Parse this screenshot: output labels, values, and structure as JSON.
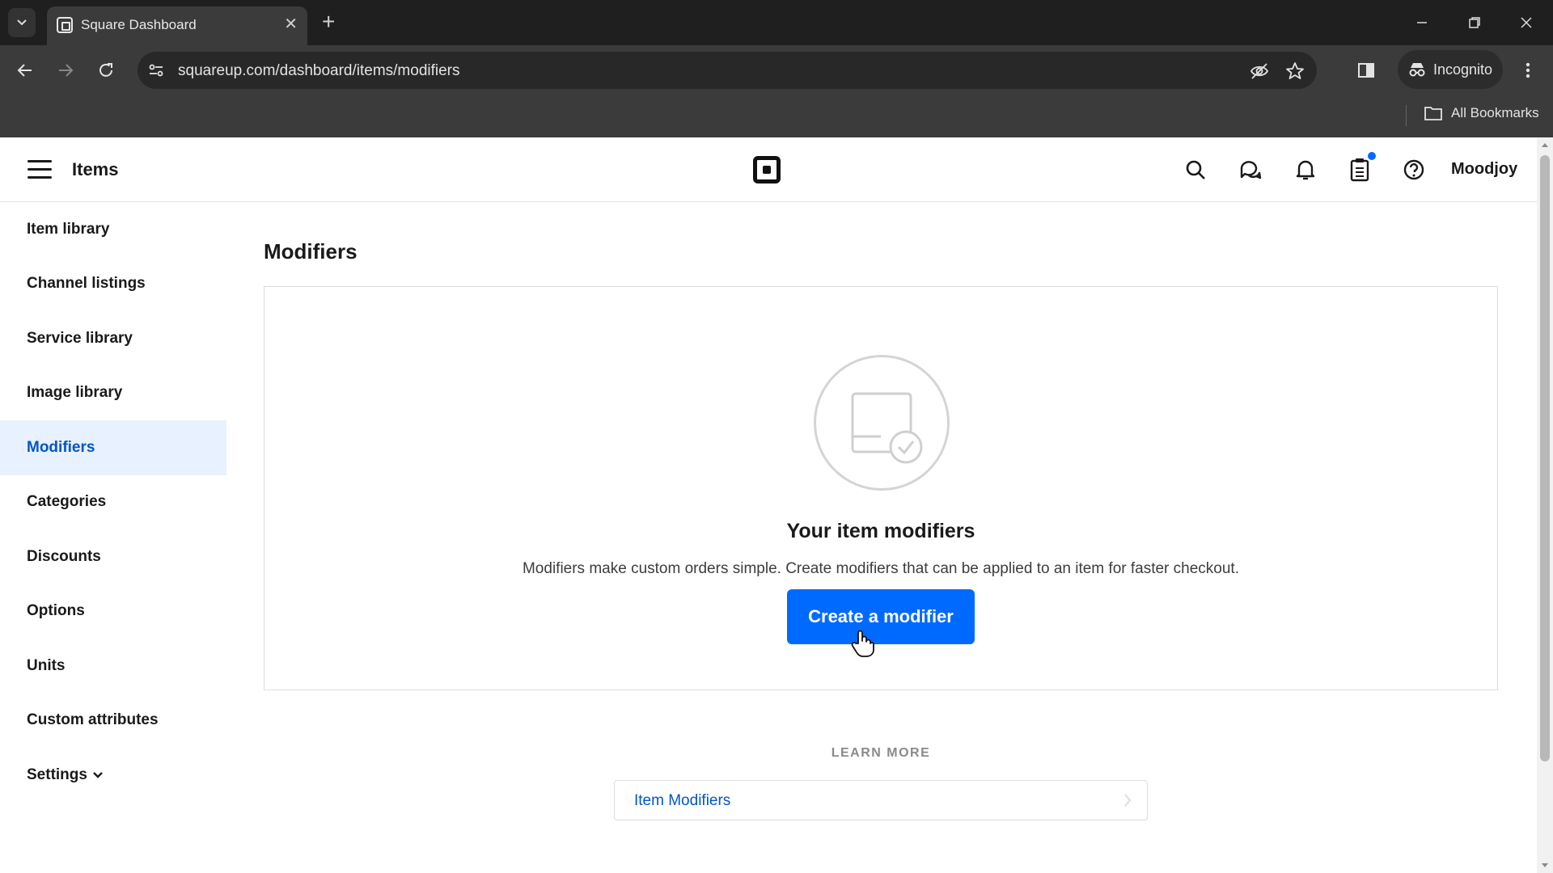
{
  "browser": {
    "tab_title": "Square Dashboard",
    "url": "squareup.com/dashboard/items/modifiers",
    "incognito_label": "Incognito",
    "bookmarks_label": "All Bookmarks"
  },
  "header": {
    "title": "Items",
    "user": "Moodjoy"
  },
  "sidebar": {
    "items": [
      {
        "label": "Item library"
      },
      {
        "label": "Channel listings"
      },
      {
        "label": "Service library"
      },
      {
        "label": "Image library"
      },
      {
        "label": "Modifiers",
        "active": true
      },
      {
        "label": "Categories"
      },
      {
        "label": "Discounts"
      },
      {
        "label": "Options"
      },
      {
        "label": "Units"
      },
      {
        "label": "Custom attributes"
      },
      {
        "label": "Settings"
      }
    ]
  },
  "main": {
    "title": "Modifiers",
    "empty_state": {
      "heading": "Your item modifiers",
      "description": "Modifiers make custom orders simple. Create modifiers that can be applied to an item for faster checkout.",
      "button_label": "Create a modifier"
    },
    "learn_more": {
      "label": "LEARN MORE",
      "links": [
        {
          "label": "Item Modifiers"
        }
      ]
    }
  },
  "colors": {
    "accent": "#006aff",
    "active_bg": "#e8f1ff",
    "link": "#0055cc"
  }
}
